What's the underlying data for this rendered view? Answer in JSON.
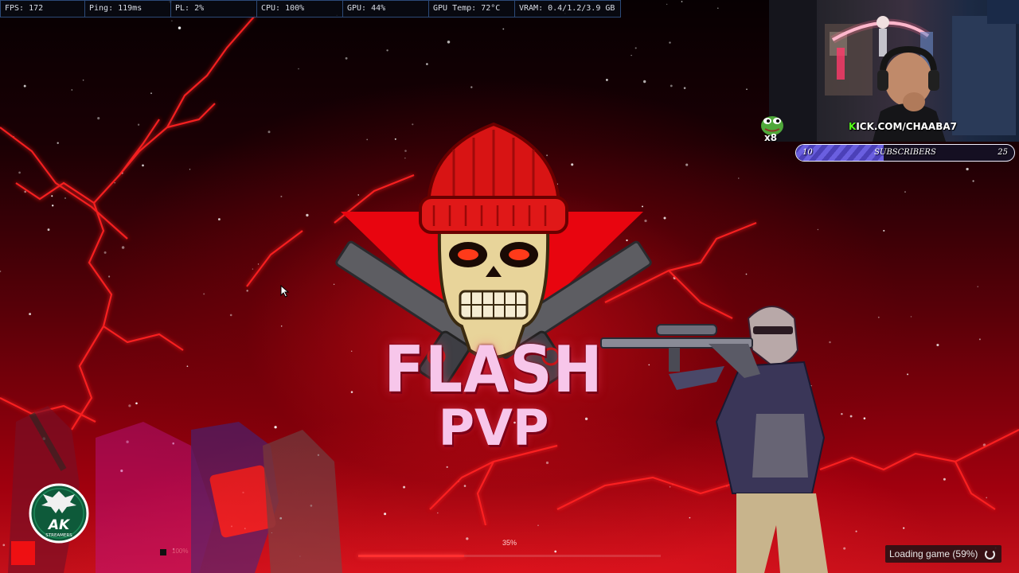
{
  "perf_overlay": {
    "fps": "FPS: 172",
    "ping": "Ping: 119ms",
    "pl": "PL: 2%",
    "cpu": "CPU: 100%",
    "gpu": "GPU: 44%",
    "gpu_temp": "GPU Temp: 72°C",
    "vram": "VRAM: 0.4/1.2/3.9 GB"
  },
  "splash": {
    "title": "FLASH",
    "subtitle": "PVP",
    "load_percent_label": "35%",
    "load_progress": 0.35,
    "tiny_percent_label": "100%",
    "loading_status": "Loading game (59%)"
  },
  "webcam": {
    "url_k": "K",
    "url_rest": "ICK.COM/CHAABA7",
    "emote_count": "x8"
  },
  "sub_goal": {
    "current": "10",
    "label": "SUBSCRIBERS",
    "target": "25",
    "progress": 0.4
  },
  "badge": {
    "text_main": "AK",
    "text_sub": "STREAMERS"
  },
  "colors": {
    "accent_red": "#e00010",
    "logo_text": "#f7c6ea",
    "kick_green": "#53fc18",
    "sub_bar": "#6a5fe0",
    "overlay_border": "#2c4a78"
  }
}
